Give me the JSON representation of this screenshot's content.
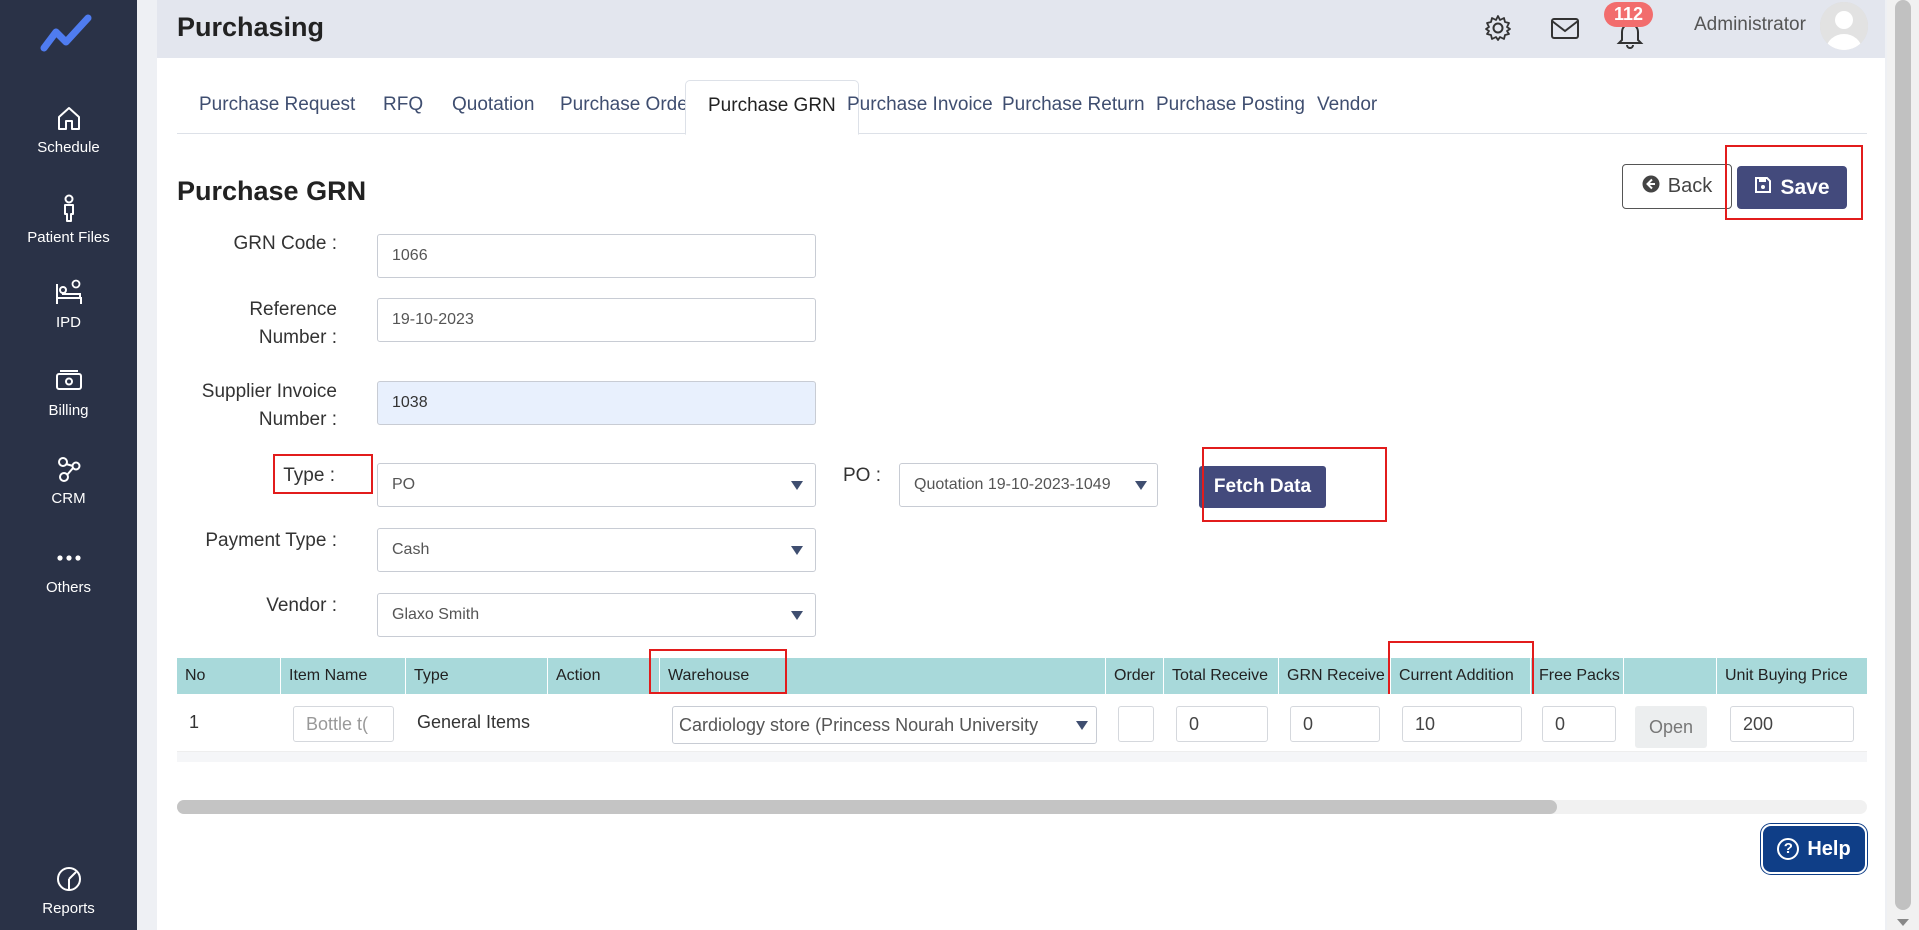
{
  "sidebar": {
    "items": [
      {
        "label": "Schedule",
        "icon": "home-icon"
      },
      {
        "label": "Patient Files",
        "icon": "person-icon"
      },
      {
        "label": "IPD",
        "icon": "bed-icon"
      },
      {
        "label": "Billing",
        "icon": "money-icon"
      },
      {
        "label": "CRM",
        "icon": "network-icon"
      },
      {
        "label": "Others",
        "icon": "more-icon"
      },
      {
        "label": "Reports",
        "icon": "pie-chart-icon"
      }
    ]
  },
  "header": {
    "title": "Purchasing",
    "notification_count": "112",
    "user": "Administrator"
  },
  "tabs": [
    "Purchase Request",
    "RFQ",
    "Quotation",
    "Purchase Order",
    "Purchase GRN",
    "Purchase Invoice",
    "Purchase Return",
    "Purchase Posting",
    "Vendor"
  ],
  "active_tab": "Purchase GRN",
  "form": {
    "title": "Purchase GRN",
    "back_label": "Back",
    "save_label": "Save",
    "grn_code_label": "GRN Code :",
    "grn_code": "1066",
    "reference_label_1": "Reference",
    "reference_label_2": "Number :",
    "reference_number": "19-10-2023",
    "supplier_label_1": "Supplier Invoice",
    "supplier_label_2": "Number :",
    "supplier_invoice": "1038",
    "type_label": "Type :",
    "type_value": "PO",
    "po_label": "PO :",
    "po_value": "Quotation 19-10-2023-1049",
    "fetch_label": "Fetch Data",
    "payment_label": "Payment Type :",
    "payment_value": "Cash",
    "vendor_label": "Vendor :",
    "vendor_value": "Glaxo Smith"
  },
  "table": {
    "headers": [
      "No",
      "Item Name",
      "Type",
      "Action",
      "Warehouse",
      "Order",
      "Total Receive",
      "GRN Receive",
      "Current Addition",
      "Free Packs",
      "",
      "Unit Buying Price"
    ],
    "rows": [
      {
        "no": "1",
        "item_name": "Bottle t(",
        "type": "General Items",
        "warehouse": "Cardiology store (Princess Nourah University",
        "order": "",
        "total_receive": "0",
        "grn_receive": "0",
        "current_addition": "10",
        "free_packs": "0",
        "open_label": "Open",
        "unit_buying_price": "200"
      }
    ]
  },
  "help_label": "Help",
  "colors": {
    "sidebar": "#2a3247",
    "primary_button": "#434a7c",
    "table_header": "#a8d9da",
    "highlight": "#e21c1c",
    "help": "#0f3e87",
    "badge": "#f26d6d"
  }
}
